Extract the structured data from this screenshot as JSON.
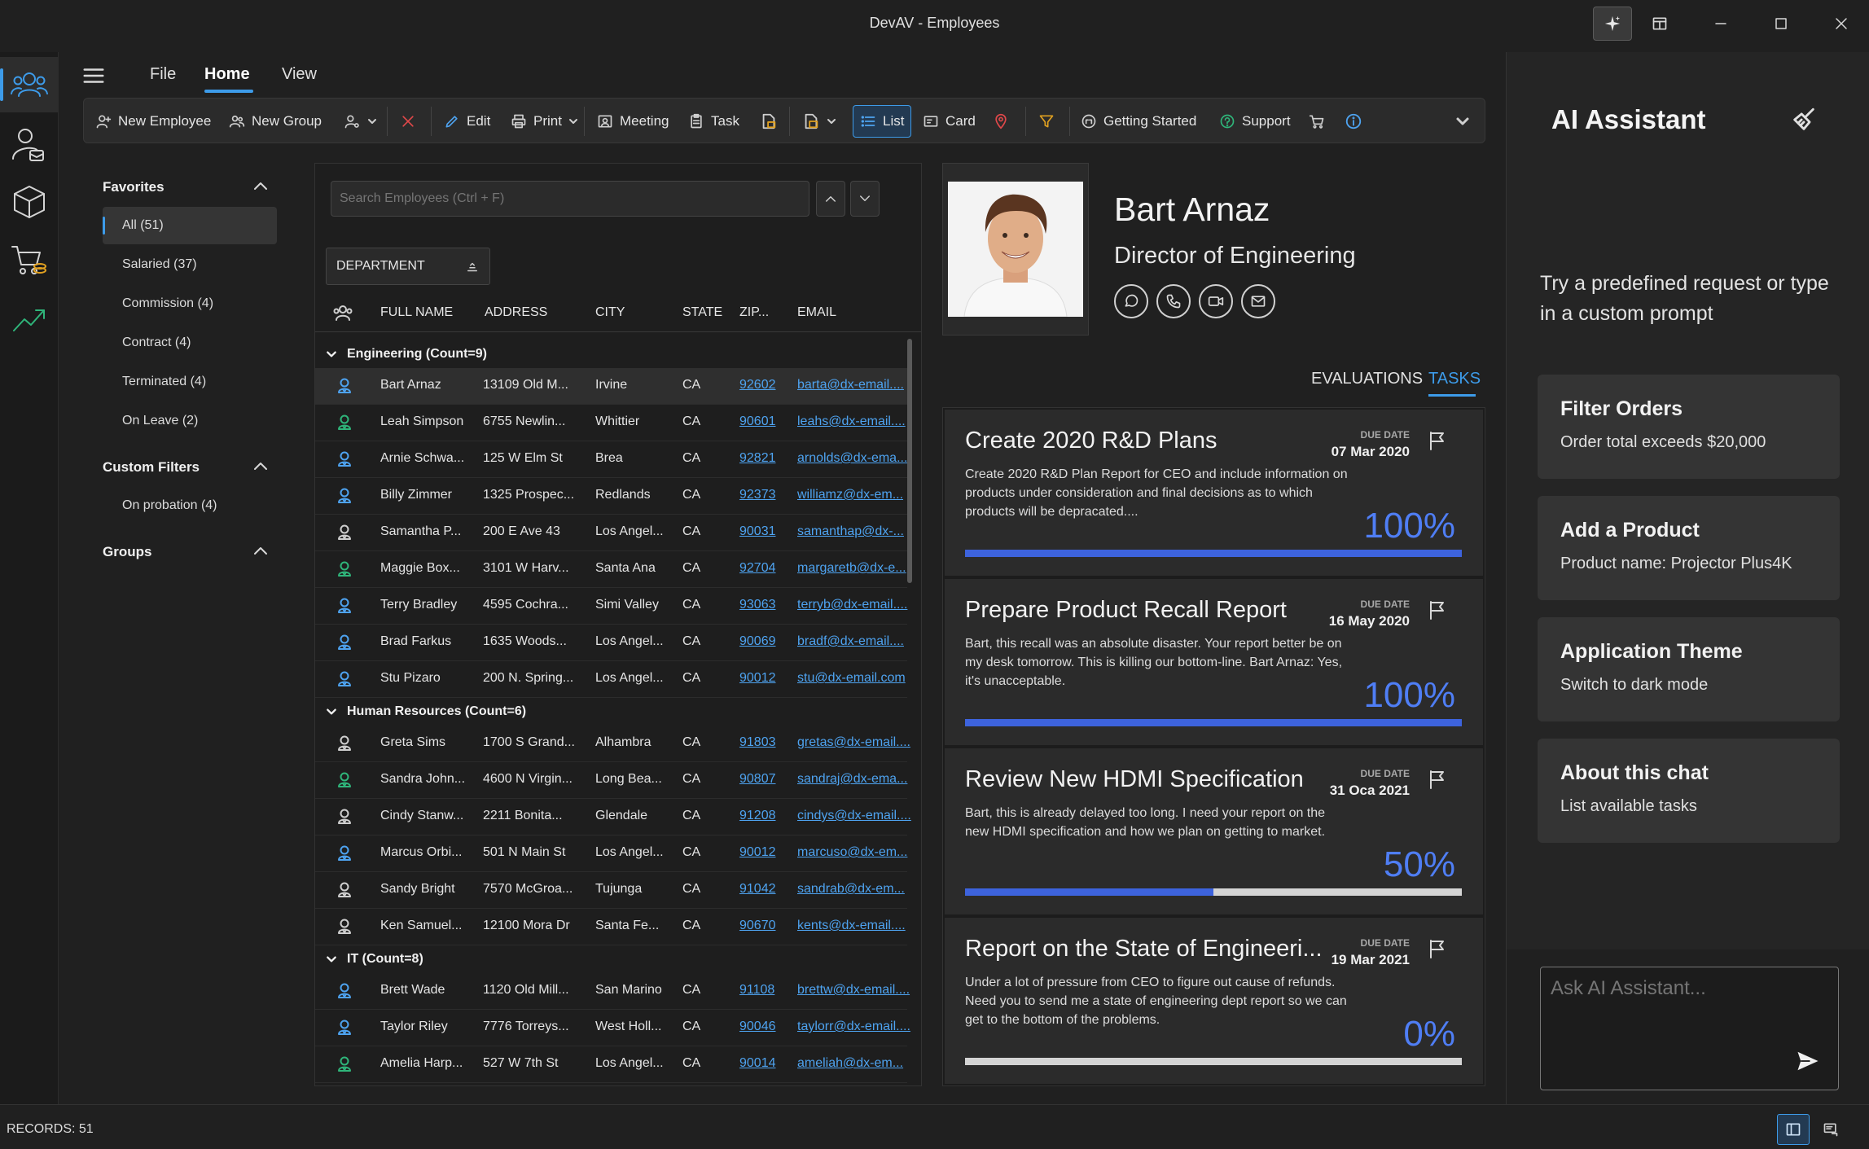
{
  "window": {
    "title": "DevAV - Employees"
  },
  "menu": {
    "file": "File",
    "home": "Home",
    "view": "View"
  },
  "ribbon": {
    "new_employee": "New Employee",
    "new_group": "New Group",
    "edit": "Edit",
    "print": "Print",
    "meeting": "Meeting",
    "task": "Task",
    "list": "List",
    "card": "Card",
    "getting_started": "Getting Started",
    "support": "Support"
  },
  "sidebar": {
    "favorites_title": "Favorites",
    "favorites": [
      "All (51)",
      "Salaried (37)",
      "Commission (4)",
      "Contract (4)",
      "Terminated (4)",
      "On Leave (2)"
    ],
    "custom_filters_title": "Custom Filters",
    "custom_filters": [
      "On probation  (4)"
    ],
    "groups_title": "Groups"
  },
  "grid": {
    "search_placeholder": "Search Employees (Ctrl + F)",
    "group_chip": "DEPARTMENT",
    "columns": {
      "full_name": "FULL NAME",
      "address": "ADDRESS",
      "city": "CITY",
      "state": "STATE",
      "zip": "ZIP...",
      "email": "EMAIL"
    },
    "groups": [
      {
        "label": "Engineering (Count=9)"
      },
      {
        "label": "Human Resources (Count=6)"
      },
      {
        "label": "IT (Count=8)"
      }
    ],
    "rows": [
      {
        "name": "Bart Arnaz",
        "address": "13109 Old M...",
        "city": "Irvine",
        "state": "CA",
        "zip": "92602",
        "email": "barta@dx-email...."
      },
      {
        "name": "Leah Simpson",
        "address": "6755 Newlin...",
        "city": "Whittier",
        "state": "CA",
        "zip": "90601",
        "email": "leahs@dx-email...."
      },
      {
        "name": "Arnie Schwa...",
        "address": "125 W Elm St",
        "city": "Brea",
        "state": "CA",
        "zip": "92821",
        "email": "arnolds@dx-ema..."
      },
      {
        "name": "Billy Zimmer",
        "address": "1325 Prospec...",
        "city": "Redlands",
        "state": "CA",
        "zip": "92373",
        "email": "williamz@dx-em..."
      },
      {
        "name": "Samantha P...",
        "address": "200 E Ave 43",
        "city": "Los Angel...",
        "state": "CA",
        "zip": "90031",
        "email": "samanthap@dx-..."
      },
      {
        "name": "Maggie Box...",
        "address": "3101 W Harv...",
        "city": "Santa Ana",
        "state": "CA",
        "zip": "92704",
        "email": "margaretb@dx-e..."
      },
      {
        "name": "Terry Bradley",
        "address": "4595 Cochra...",
        "city": "Simi Valley",
        "state": "CA",
        "zip": "93063",
        "email": "terryb@dx-email...."
      },
      {
        "name": "Brad Farkus",
        "address": "1635 Woods...",
        "city": "Los Angel...",
        "state": "CA",
        "zip": "90069",
        "email": "bradf@dx-email...."
      },
      {
        "name": "Stu Pizaro",
        "address": "200 N. Spring...",
        "city": "Los Angel...",
        "state": "CA",
        "zip": "90012",
        "email": "stu@dx-email.com"
      },
      {
        "name": "Greta Sims",
        "address": "1700 S Grand...",
        "city": "Alhambra",
        "state": "CA",
        "zip": "91803",
        "email": "gretas@dx-email...."
      },
      {
        "name": "Sandra John...",
        "address": "4600 N Virgin...",
        "city": "Long Bea...",
        "state": "CA",
        "zip": "90807",
        "email": "sandraj@dx-ema..."
      },
      {
        "name": "Cindy Stanw...",
        "address": "2211 Bonita...",
        "city": "Glendale",
        "state": "CA",
        "zip": "91208",
        "email": "cindys@dx-email...."
      },
      {
        "name": "Marcus Orbi...",
        "address": "501 N Main St",
        "city": "Los Angel...",
        "state": "CA",
        "zip": "90012",
        "email": "marcuso@dx-em..."
      },
      {
        "name": "Sandy Bright",
        "address": "7570 McGroa...",
        "city": "Tujunga",
        "state": "CA",
        "zip": "91042",
        "email": "sandrab@dx-em..."
      },
      {
        "name": "Ken Samuel...",
        "address": "12100 Mora Dr",
        "city": "Santa Fe...",
        "state": "CA",
        "zip": "90670",
        "email": "kents@dx-email...."
      },
      {
        "name": "Brett Wade",
        "address": "1120 Old Mill...",
        "city": "San Marino",
        "state": "CA",
        "zip": "91108",
        "email": "brettw@dx-email...."
      },
      {
        "name": "Taylor Riley",
        "address": "7776 Torreys...",
        "city": "West Holl...",
        "state": "CA",
        "zip": "90046",
        "email": "taylorr@dx-email...."
      },
      {
        "name": "Amelia Harp...",
        "address": "527 W 7th St",
        "city": "Los Angel...",
        "state": "CA",
        "zip": "90014",
        "email": "ameliah@dx-em..."
      }
    ]
  },
  "detail": {
    "name": "Bart Arnaz",
    "title": "Director of Engineering",
    "tab_evaluations": "EVALUATIONS",
    "tab_tasks": "TASKS",
    "due_label": "DUE DATE",
    "tasks": [
      {
        "title": "Create 2020 R&D Plans",
        "due": "07 Mar 2020",
        "desc": "Create 2020 R&D Plan Report for CEO and include information on products under consideration and final decisions as to which products will be depracated....",
        "percent": "100%",
        "progress": 1.0
      },
      {
        "title": "Prepare Product Recall Report",
        "due": "16 May 2020",
        "desc": "Bart, this recall was an absolute disaster. Your report better be on my desk tomorrow. This is killing our bottom-line. Bart Arnaz: Yes, it's unacceptable.",
        "percent": "100%",
        "progress": 1.0
      },
      {
        "title": "Review New HDMI Specification",
        "due": "31 Oca 2021",
        "desc": "Bart, this is already delayed too long. I need your report on the new HDMI specification and how we plan on getting to market.",
        "percent": "50%",
        "progress": 0.5
      },
      {
        "title": "Report on the State of Engineeri...",
        "due": "19 Mar 2021",
        "desc": "Under a lot of pressure from CEO to figure out cause of refunds. Need you to send me a state of engineering dept report so we can get to the bottom of the problems.",
        "percent": "0%",
        "progress": 0.0
      }
    ]
  },
  "ai": {
    "title": "AI Assistant",
    "hint": "Try a predefined request or type in a custom prompt",
    "cards": [
      {
        "title": "Filter Orders",
        "subtitle": "Order total exceeds $20,000"
      },
      {
        "title": "Add a Product",
        "subtitle": "Product name: Projector Plus4K"
      },
      {
        "title": "Application Theme",
        "subtitle": "Switch to dark mode"
      },
      {
        "title": "About this chat",
        "subtitle": "List available tasks"
      }
    ],
    "input_placeholder": "Ask AI Assistant..."
  },
  "status": {
    "records": "RECORDS: 51"
  },
  "colors": {
    "accent": "#3d9be9",
    "progress": "#3d63dd",
    "link": "#4ea3f0",
    "status_green": "#2fb57a"
  }
}
